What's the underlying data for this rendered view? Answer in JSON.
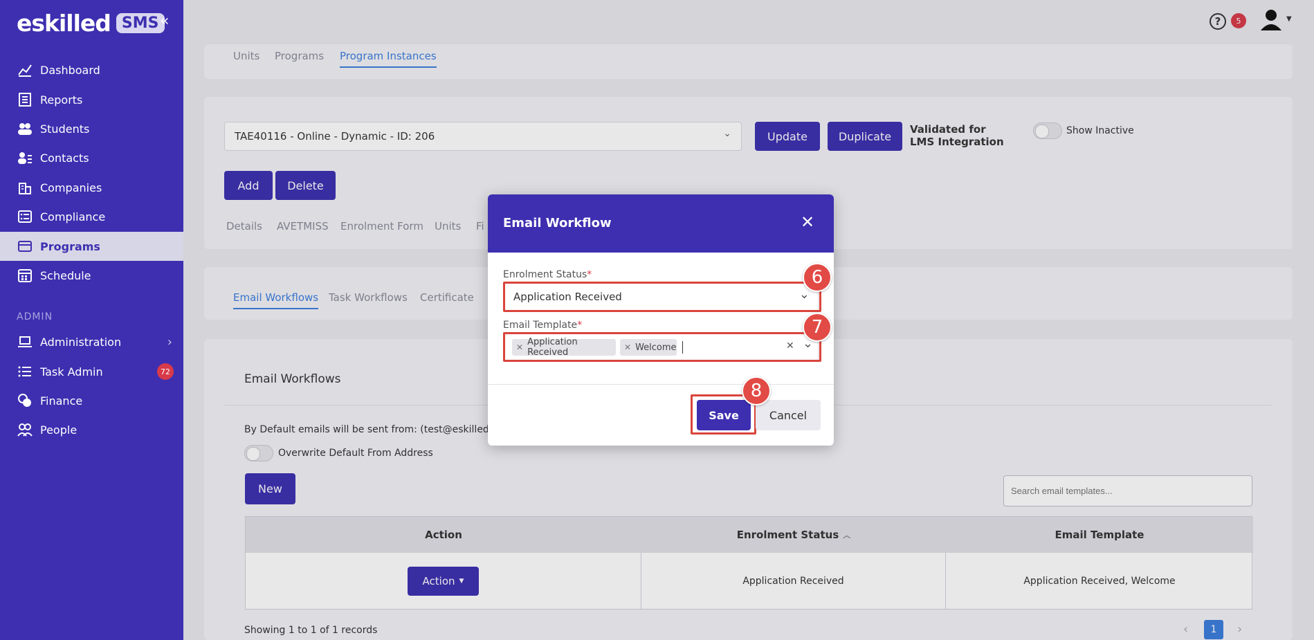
{
  "brand": {
    "logo_text": "eskilled",
    "logo_badge": "SMS"
  },
  "sidebar": {
    "items": [
      {
        "label": "Dashboard",
        "icon": "chart-line-icon"
      },
      {
        "label": "Reports",
        "icon": "report-icon"
      },
      {
        "label": "Students",
        "icon": "students-icon"
      },
      {
        "label": "Contacts",
        "icon": "contacts-icon"
      },
      {
        "label": "Companies",
        "icon": "building-icon"
      },
      {
        "label": "Compliance",
        "icon": "checklist-icon"
      },
      {
        "label": "Programs",
        "icon": "programs-icon",
        "active": true
      },
      {
        "label": "Schedule",
        "icon": "calendar-icon"
      }
    ],
    "section_label": "ADMIN",
    "admin_items": [
      {
        "label": "Administration",
        "icon": "laptop-icon"
      },
      {
        "label": "Task Admin",
        "icon": "list-icon",
        "badge": "72"
      },
      {
        "label": "Finance",
        "icon": "coins-icon"
      },
      {
        "label": "People",
        "icon": "people-icon"
      }
    ]
  },
  "topbar": {
    "help_badge": "5"
  },
  "top_tabs": [
    "Units",
    "Programs",
    "Program Instances"
  ],
  "program": {
    "selected": "TAE40116 - Online - Dynamic - ID: 206",
    "update_label": "Update",
    "duplicate_label": "Duplicate",
    "validated_label": "Validated for LMS Integration",
    "show_inactive_label": "Show Inactive",
    "add_label": "Add",
    "delete_label": "Delete",
    "sub_tabs": [
      "Details",
      "AVETMISS",
      "Enrolment Form",
      "Units",
      "Fi"
    ]
  },
  "workflow_tabs": [
    "Email Workflows",
    "Task Workflows",
    "Certificate"
  ],
  "email_workflows": {
    "title": "Email Workflows",
    "default_from": "By Default emails will be sent from: (test@eskilled.com",
    "overwrite_label": "Overwrite Default From Address",
    "new_label": "New",
    "search_placeholder": "Search email templates...",
    "columns": [
      "Action",
      "Enrolment Status",
      "Email Template"
    ],
    "rows": [
      {
        "action": "Action",
        "status": "Application Received",
        "template": "Application Received, Welcome"
      }
    ],
    "showing": "Showing 1 to 1 of 1 records",
    "page": "1"
  },
  "modal": {
    "title": "Email Workflow",
    "status_label": "Enrolment Status",
    "status_value": "Application Received",
    "template_label": "Email Template",
    "template_chips": [
      "Application Received",
      "Welcome"
    ],
    "save_label": "Save",
    "cancel_label": "Cancel",
    "steps": [
      "6",
      "7",
      "8"
    ]
  },
  "colors": {
    "primary": "#3d2fb0",
    "highlight": "#d9443c",
    "link": "#3b7ddd"
  }
}
